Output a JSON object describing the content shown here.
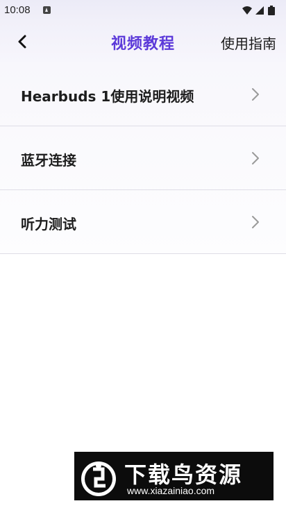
{
  "status_bar": {
    "time": "10:08",
    "notification_icon": "a-notification-icon",
    "system_icons": [
      "wifi-icon",
      "signal-icon",
      "battery-icon"
    ]
  },
  "header": {
    "back_icon": "chevron-left-icon",
    "title": "视频教程",
    "guide_label": "使用指南",
    "title_color": "#5b39d9"
  },
  "list": {
    "items": [
      {
        "label": "Hearbuds 1使用说明视频",
        "icon": "chevron-right-icon"
      },
      {
        "label": "蓝牙连接",
        "icon": "chevron-right-icon"
      },
      {
        "label": "听力测试",
        "icon": "chevron-right-icon"
      }
    ]
  },
  "watermark": {
    "text": "下载鸟资源",
    "url": "www.xiazainiao.com"
  }
}
